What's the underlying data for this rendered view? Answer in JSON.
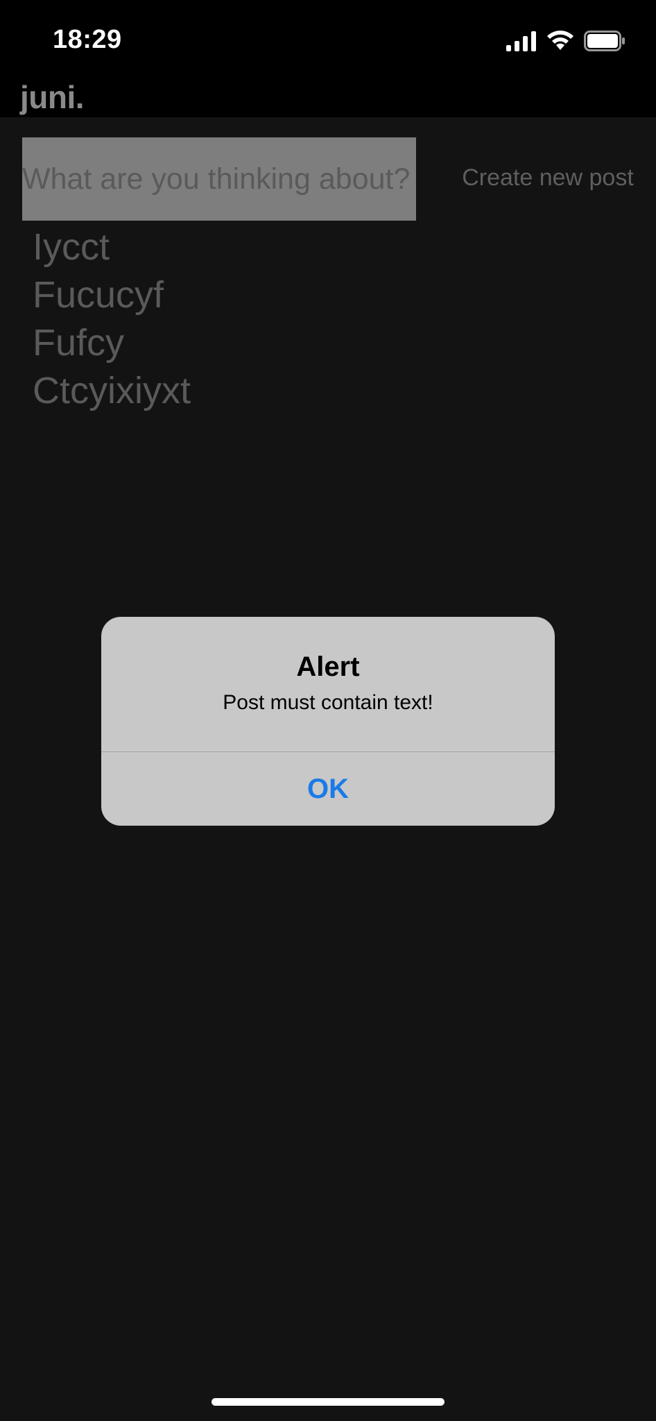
{
  "status_bar": {
    "time": "18:29",
    "icons": [
      "cellular-signal-icon",
      "wifi-icon",
      "battery-icon"
    ]
  },
  "header": {
    "title": "juni."
  },
  "composer": {
    "placeholder": "What are you thinking about?",
    "value": "",
    "create_label": "Create new post"
  },
  "posts": [
    "Iycct",
    "Fucucyf",
    "Fufcy",
    "Ctcyixiyxt"
  ],
  "alert": {
    "title": "Alert",
    "message": "Post must contain text!",
    "ok_label": "OK"
  },
  "colors": {
    "background": "#131313",
    "alert_background": "#c8c8c8",
    "accent": "#1a7ae8"
  }
}
